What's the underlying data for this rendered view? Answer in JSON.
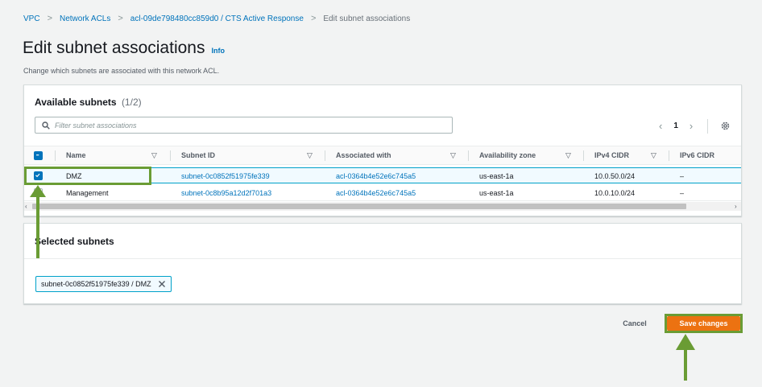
{
  "breadcrumb": {
    "items": [
      "VPC",
      "Network ACLs",
      "acl-09de798480cc859d0 / CTS Active Response"
    ],
    "current": "Edit subnet associations",
    "separator": ">"
  },
  "page": {
    "title": "Edit subnet associations",
    "info": "Info",
    "description": "Change which subnets are associated with this network ACL."
  },
  "available": {
    "title": "Available subnets",
    "count": "(1/2)",
    "filter_placeholder": "Filter subnet associations",
    "page": "1",
    "prev_icon": "chevron-left-icon",
    "next_icon": "chevron-right-icon",
    "settings_icon": "gear-icon",
    "columns": [
      "Name",
      "Subnet ID",
      "Associated with",
      "Availability zone",
      "IPv4 CIDR",
      "IPv6 CIDR"
    ],
    "rows": [
      {
        "name": "DMZ",
        "subnet_id": "subnet-0c0852f51975fe339",
        "associated_with": "acl-0364b4e52e6c745a5",
        "az": "us-east-1a",
        "ipv4": "10.0.50.0/24",
        "ipv6": "–",
        "selected": true
      },
      {
        "name": "Management",
        "subnet_id": "subnet-0c8b95a12d2f701a3",
        "associated_with": "acl-0364b4e52e6c745a5",
        "az": "us-east-1a",
        "ipv4": "10.0.10.0/24",
        "ipv6": "–",
        "selected": false
      }
    ]
  },
  "selected": {
    "title": "Selected subnets",
    "token_label": "subnet-0c0852f51975fe339 / DMZ",
    "remove_icon": "close-icon"
  },
  "actions": {
    "cancel": "Cancel",
    "save": "Save changes"
  },
  "colors": {
    "accent": "#0073bb",
    "primary_button": "#ec7211",
    "annotation": "#6a9c34"
  }
}
